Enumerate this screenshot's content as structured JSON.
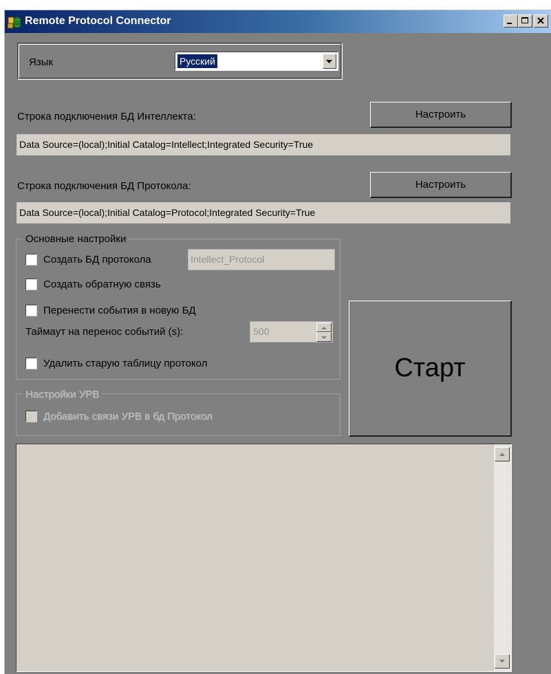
{
  "window": {
    "title": "Remote Protocol Connector",
    "icon": "app-database-icon"
  },
  "language": {
    "label": "Язык",
    "selected": "Русский"
  },
  "intellect_db": {
    "label": "Строка подключения БД Интеллекта:",
    "button": "Настроить",
    "connection_string": "Data Source=(local);Initial Catalog=Intellect;Integrated Security=True"
  },
  "protocol_db": {
    "label": "Строка подключения БД Протокола:",
    "button": "Настроить",
    "connection_string": "Data Source=(local);Initial Catalog=Protocol;Integrated Security=True"
  },
  "main_settings": {
    "title": "Основные настройки",
    "create_db": {
      "label": "Создать БД протокола",
      "checked": false,
      "db_name": "Intellect_Protocol"
    },
    "create_feedback": {
      "label": "Создать обратную связь",
      "checked": false
    },
    "transfer_events": {
      "label": "Перенести события в новую БД",
      "checked": false
    },
    "timeout": {
      "label": "Таймаут на перенос событий (s):",
      "value": "500"
    },
    "delete_old": {
      "label": "Удалить старую таблицу протокол",
      "checked": false
    }
  },
  "urv_settings": {
    "title": "Настройки УРВ",
    "add_links": {
      "label": "Добавить связи УРВ в бд Протокол",
      "checked": false
    }
  },
  "start_button": "Старт",
  "log": {
    "text": ""
  }
}
